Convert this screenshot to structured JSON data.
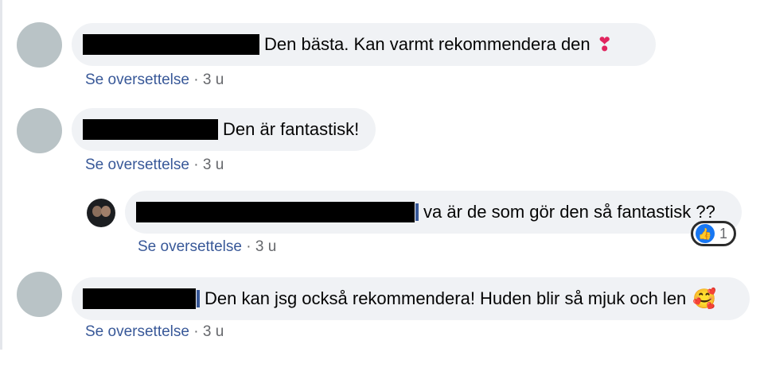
{
  "comments": [
    {
      "text": "Den bästa. Kan varmt rekommendera den",
      "emoji": "❣",
      "meta": {
        "translate_label": "Se oversettelse",
        "separator": " · ",
        "time": "3 u"
      }
    },
    {
      "text": "Den är fantastisk!",
      "meta": {
        "translate_label": "Se oversettelse",
        "separator": " · ",
        "time": "3 u"
      }
    },
    {
      "text": "va är de som gör den så fantastisk ??",
      "reaction": {
        "icon": "like-icon",
        "count": "1"
      },
      "meta": {
        "translate_label": "Se oversettelse",
        "separator": " · ",
        "time": "3 u"
      }
    },
    {
      "text": "Den kan jsg också rekommendera! Huden blir så mjuk och len",
      "emoji": "🥰",
      "meta": {
        "translate_label": "Se oversettelse",
        "separator": " · ",
        "time": "3 u"
      }
    }
  ],
  "colors": {
    "bubble": "#f0f2f5",
    "link": "#385898",
    "meta": "#65676b",
    "like": "#1877f2"
  }
}
